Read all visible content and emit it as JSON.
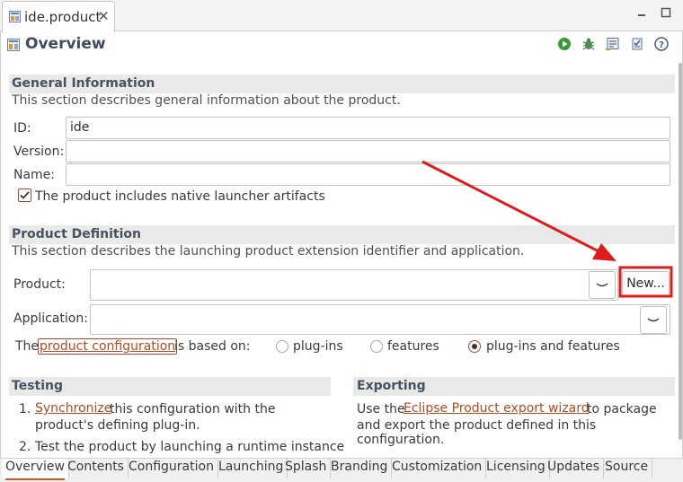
{
  "editor_tab": {
    "label": "ide.product",
    "close_glyph": "✕"
  },
  "window_controls": {
    "minimize_icon": "minimize-icon",
    "maximize_icon": "maximize-icon"
  },
  "header": {
    "title": "Overview",
    "icons": [
      "run-icon",
      "debug-icon",
      "export-icon",
      "sync-icon",
      "help-icon"
    ]
  },
  "general": {
    "title": "General Information",
    "description": "This section describes general information about the product.",
    "id_label": "ID:",
    "id_value": "ide",
    "version_label": "Version:",
    "version_value": "",
    "name_label": "Name:",
    "name_value": "",
    "launcher_checkbox_label": "The product includes native launcher artifacts",
    "launcher_checked": true
  },
  "product_definition": {
    "title": "Product Definition",
    "description": "This section describes the launching product extension identifier and application.",
    "product_label": "Product:",
    "product_value": "",
    "new_button": "New...",
    "application_label": "Application:",
    "application_value": "",
    "config_prefix": "The",
    "config_link": "product configuration",
    "config_suffix": "is based on:",
    "options": [
      "plug-ins",
      "features",
      "plug-ins and features"
    ],
    "selected_option": "plug-ins and features"
  },
  "testing": {
    "title": "Testing",
    "item1_num": "1.",
    "item1_link": "Synchronize",
    "item1_text_a": "this configuration with the",
    "item1_text_b": "product's defining plug-in.",
    "item2_num": "2.",
    "item2_text": "Test the product by launching a runtime instance"
  },
  "exporting": {
    "title": "Exporting",
    "text_prefix": "Use the",
    "link": "Eclipse Product export wizard",
    "text_suffix": "to package",
    "text_line2": "and export the product defined in this configuration."
  },
  "bottom_tabs": [
    "Overview",
    "Contents",
    "Configuration",
    "Launching",
    "Splash",
    "Branding",
    "Customization",
    "Licensing",
    "Updates",
    "Source"
  ],
  "active_bottom_tab": "Overview",
  "annotation": {
    "color": "#e01b1b"
  }
}
